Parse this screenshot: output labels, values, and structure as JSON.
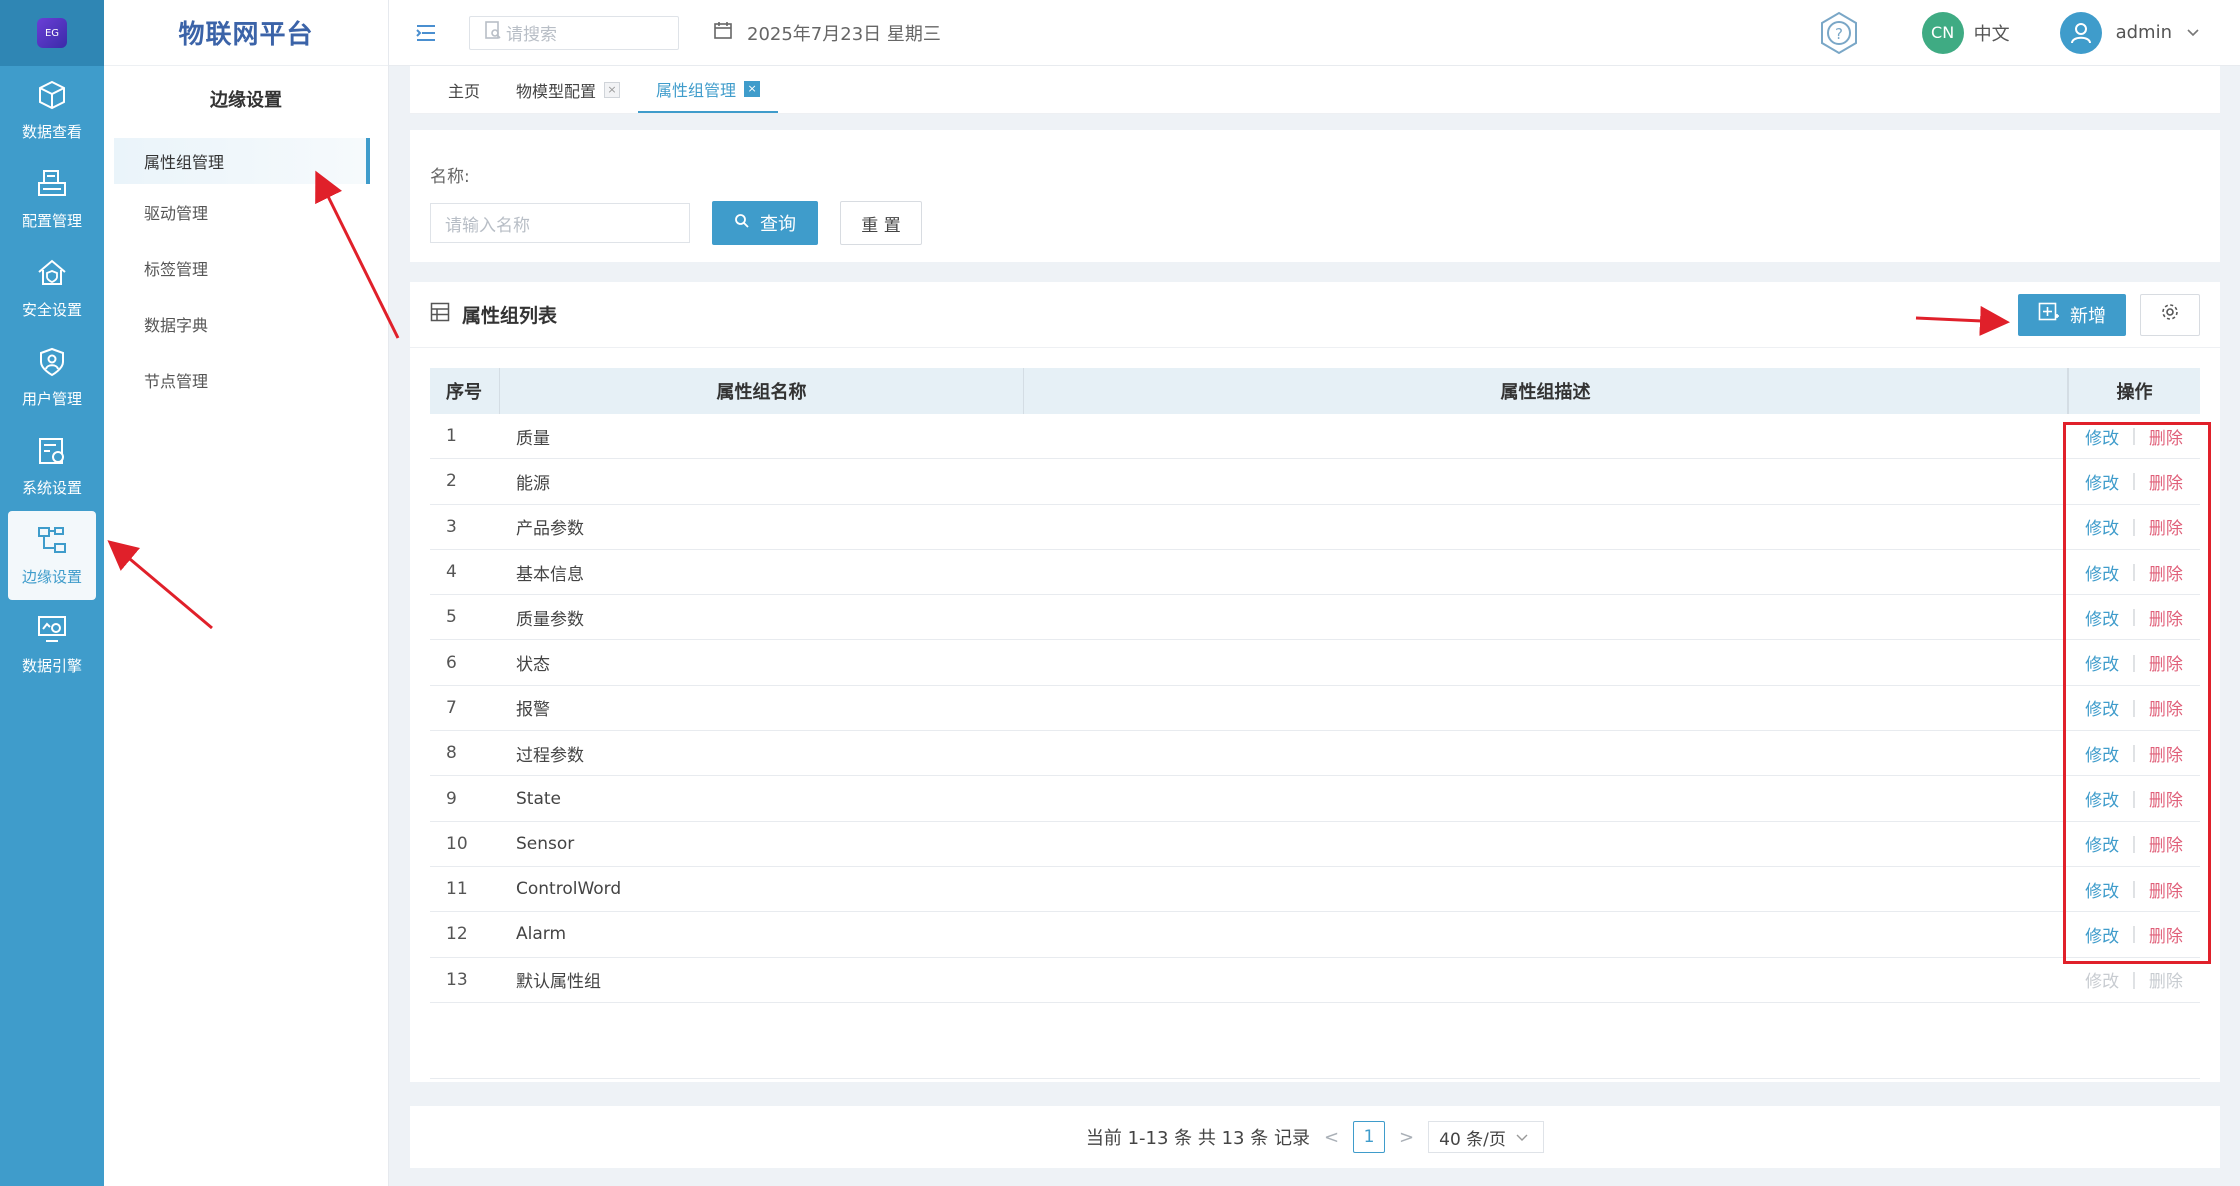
{
  "rail": {
    "logo_text": "EG",
    "items": [
      {
        "label": "数据查看",
        "icon": "cube-icon"
      },
      {
        "label": "配置管理",
        "icon": "printer-icon"
      },
      {
        "label": "安全设置",
        "icon": "house-shield-icon"
      },
      {
        "label": "用户管理",
        "icon": "user-shield-icon"
      },
      {
        "label": "系统设置",
        "icon": "system-settings-icon"
      },
      {
        "label": "边缘设置",
        "icon": "edge-network-icon",
        "active": true
      },
      {
        "label": "数据引擎",
        "icon": "engine-monitor-icon"
      }
    ]
  },
  "brand": "物联网平台",
  "submenu": {
    "title": "边缘设置",
    "items": [
      {
        "label": "属性组管理",
        "active": true
      },
      {
        "label": "驱动管理"
      },
      {
        "label": "标签管理"
      },
      {
        "label": "数据字典"
      },
      {
        "label": "节点管理"
      }
    ]
  },
  "topbar": {
    "search_placeholder": "请搜索",
    "date": "2025年7月23日 星期三",
    "lang_badge": "CN",
    "lang_label": "中文",
    "user_name": "admin"
  },
  "tabs": [
    {
      "label": "主页",
      "closable": false,
      "active": false
    },
    {
      "label": "物模型配置",
      "closable": true,
      "active": false
    },
    {
      "label": "属性组管理",
      "closable": true,
      "active": true
    }
  ],
  "search": {
    "name_label": "名称:",
    "name_placeholder": "请输入名称",
    "query_label": "查询",
    "reset_label": "重 置"
  },
  "list": {
    "title": "属性组列表",
    "add_label": "新增",
    "columns": [
      "序号",
      "属性组名称",
      "属性组描述",
      "操作"
    ],
    "edit_label": "修改",
    "delete_label": "删除",
    "rows": [
      {
        "index": "1",
        "name": "质量",
        "desc": ""
      },
      {
        "index": "2",
        "name": "能源",
        "desc": ""
      },
      {
        "index": "3",
        "name": "产品参数",
        "desc": ""
      },
      {
        "index": "4",
        "name": "基本信息",
        "desc": ""
      },
      {
        "index": "5",
        "name": "质量参数",
        "desc": ""
      },
      {
        "index": "6",
        "name": "状态",
        "desc": ""
      },
      {
        "index": "7",
        "name": "报警",
        "desc": ""
      },
      {
        "index": "8",
        "name": "过程参数",
        "desc": ""
      },
      {
        "index": "9",
        "name": "State",
        "desc": ""
      },
      {
        "index": "10",
        "name": "Sensor",
        "desc": ""
      },
      {
        "index": "11",
        "name": "ControlWord",
        "desc": ""
      },
      {
        "index": "12",
        "name": "Alarm",
        "desc": ""
      },
      {
        "index": "13",
        "name": "默认属性组",
        "desc": "",
        "disabled": true
      }
    ]
  },
  "pager": {
    "summary": "当前 1-13 条 共 13 条 记录",
    "prev": "<",
    "current_page": "1",
    "next": ">",
    "page_size": "40 条/页"
  },
  "colors": {
    "accent": "#3f9ccb",
    "danger": "#e0607a",
    "annotation": "#e0202a"
  }
}
